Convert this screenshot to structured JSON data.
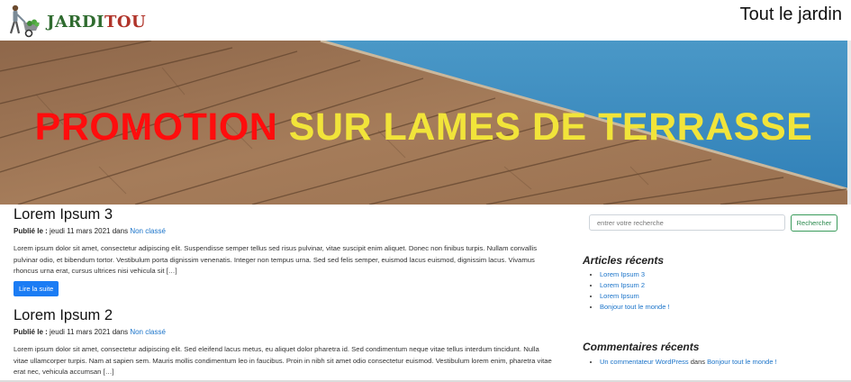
{
  "header": {
    "logo_part1": "JARDI",
    "logo_part2": "TOU",
    "site_title": "Tout le jardin"
  },
  "hero": {
    "headline_red": "PROMOTION",
    "headline_yellow": "SUR LAMES DE TERRASSE"
  },
  "posts": [
    {
      "title": "Lorem Ipsum 3",
      "published_label": "Publié le :",
      "date": "jeudi 11 mars 2021",
      "in_label": "dans",
      "category": "Non classé",
      "excerpt": "Lorem ipsum dolor sit amet, consectetur adipiscing elit. Suspendisse semper tellus sed risus pulvinar, vitae suscipit enim aliquet. Donec non finibus turpis. Nullam convallis pulvinar odio, et bibendum tortor. Vestibulum porta dignissim venenatis. Integer non tempus urna. Sed sed felis semper, euismod lacus euismod, dignissim lacus. Vivamus rhoncus urna erat, cursus ultrices nisi vehicula sit […]",
      "read_more": "Lire la suite"
    },
    {
      "title": "Lorem Ipsum 2",
      "published_label": "Publié le :",
      "date": "jeudi 11 mars 2021",
      "in_label": "dans",
      "category": "Non classé",
      "excerpt": "Lorem ipsum dolor sit amet, consectetur adipiscing elit. Sed eleifend lacus metus, eu aliquet dolor pharetra id. Sed condimentum neque vitae tellus interdum tincidunt. Nulla vitae ullamcorper turpis. Nam at sapien sem. Mauris mollis condimentum leo in faucibus. Proin in nibh sit amet odio consectetur euismod. Vestibulum lorem enim, pharetra vitae erat nec, vehicula accumsan […]"
    }
  ],
  "sidebar": {
    "search_placeholder": "entrer votre recherche",
    "search_button": "Rechercher",
    "recent_articles_title": "Articles récents",
    "recent_articles": [
      "Lorem Ipsum 3",
      "Lorem Ipsum 2",
      "Lorem Ipsum",
      "Bonjour tout le monde !"
    ],
    "recent_comments_title": "Commentaires récents",
    "comment_author": "Un commentateur WordPress",
    "comment_in": "dans",
    "comment_post": "Bonjour tout le monde !"
  },
  "colors": {
    "link": "#1a73c9",
    "button_primary": "#1b7cf4",
    "search_button": "#2b8a4d",
    "hero_red": "#ff0d0d",
    "hero_yellow": "#f1e43a"
  }
}
